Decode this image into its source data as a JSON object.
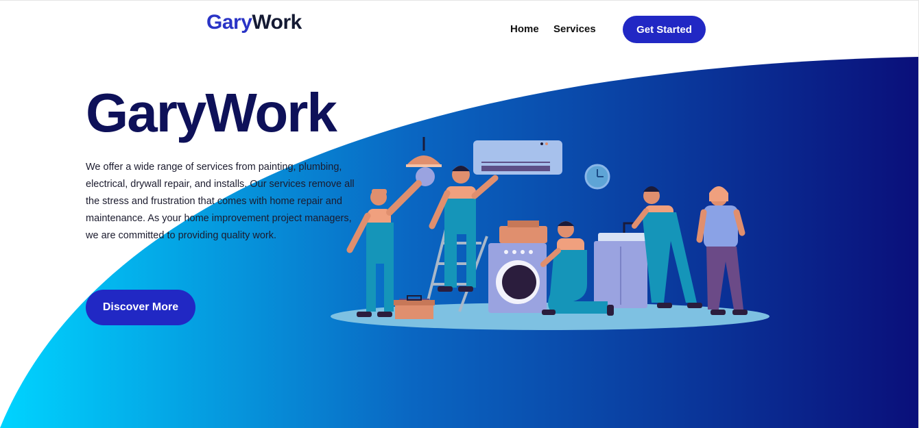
{
  "header": {
    "logo_part1": "Gary",
    "logo_part2": "Work",
    "nav": [
      {
        "label": "Home"
      },
      {
        "label": "Services"
      }
    ],
    "cta_label": "Get Started"
  },
  "hero": {
    "title": "GaryWork",
    "description": "We offer a wide range of services from painting, plumbing, electrical, drywall repair, and installs. Our services remove all the stress and frustration that comes with home repair and maintenance. As your home improvement project managers, we are committed to providing quality work.",
    "button_label": "Discover More"
  },
  "colors": {
    "accent": "#2128c4",
    "title": "#0e1159",
    "gradient_start": "#00d4ff",
    "gradient_mid": "#0a66c2",
    "gradient_end": "#0a0f7a"
  },
  "illustration": {
    "icons": [
      "ceiling-lamp-icon",
      "air-conditioner-icon",
      "wall-clock-icon",
      "washing-machine-icon",
      "ladder-icon",
      "toolbox-icon",
      "sink-cabinet-icon",
      "worker-icon"
    ]
  }
}
